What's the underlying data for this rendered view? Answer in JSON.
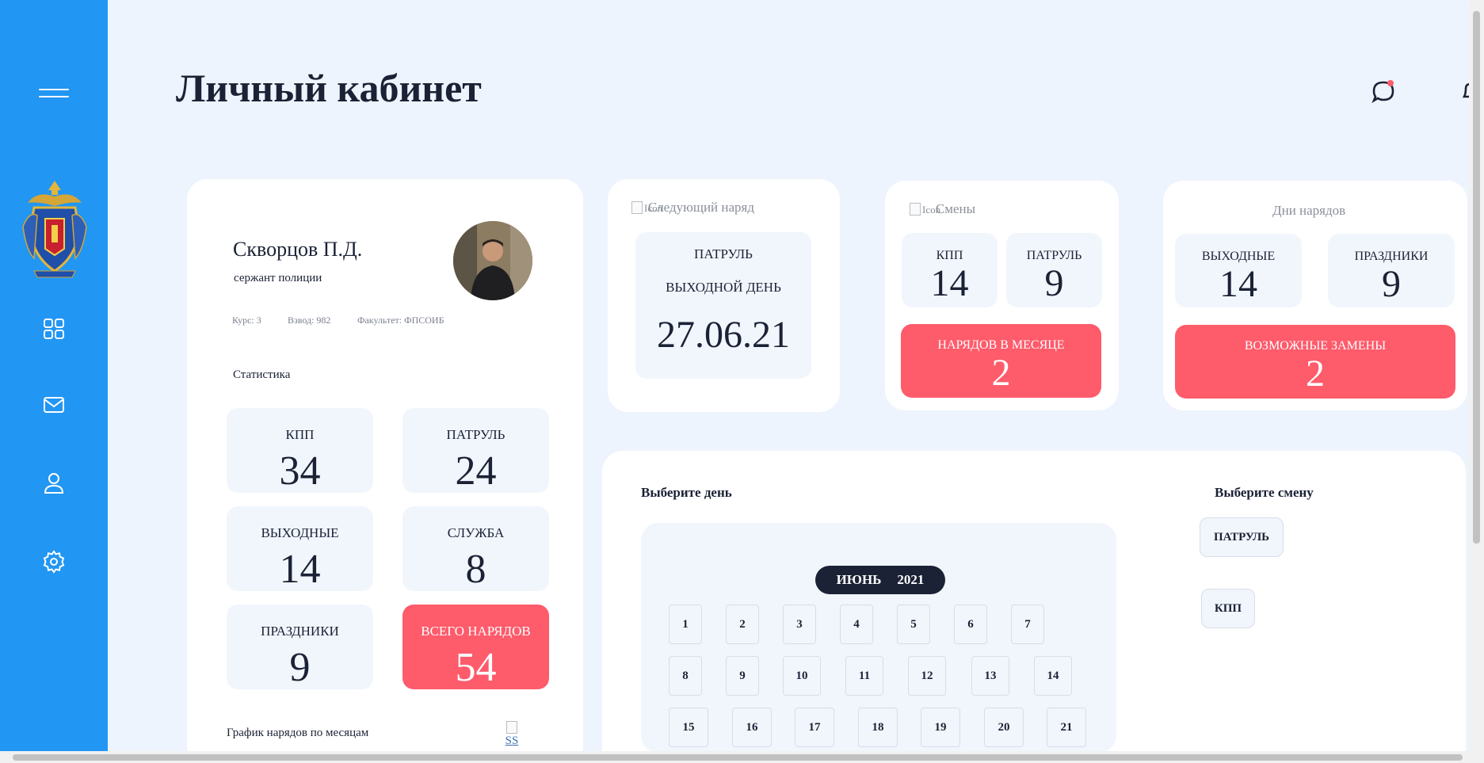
{
  "header": {
    "title": "Личный кабинет",
    "chat_icon": "chat-icon",
    "bell_icon": "bell-icon"
  },
  "sidebar": {
    "menu_icon": "hamburger-icon",
    "logo": "police-emblem",
    "items": [
      {
        "name": "dashboard",
        "icon": "grid-icon"
      },
      {
        "name": "messages",
        "icon": "mail-icon"
      },
      {
        "name": "profile",
        "icon": "user-icon"
      },
      {
        "name": "settings",
        "icon": "gear-icon"
      }
    ]
  },
  "profile": {
    "name": "Скворцов П.Д.",
    "rank": "сержант полиции",
    "course": "Курс: 3",
    "platoon": "Взвод: 982",
    "faculty": "Факультет: ФПСОИБ",
    "stats_title": "Статистика",
    "stats": [
      {
        "label": "КПП",
        "value": "34"
      },
      {
        "label": "ПАТРУЛЬ",
        "value": "24"
      },
      {
        "label": "ВЫХОДНЫЕ",
        "value": "14"
      },
      {
        "label": "СЛУЖБА",
        "value": "8"
      },
      {
        "label": "ПРАЗДНИКИ",
        "value": "9"
      },
      {
        "label": "ВСЕГО НАРЯДОВ",
        "value": "54"
      }
    ],
    "chart_title": "График нарядов по месяцам",
    "chart_alt": "SS"
  },
  "next_duty": {
    "icon_alt": "Icon",
    "title": "Следующий наряд",
    "type": "ПАТРУЛЬ",
    "day": "ВЫХОДНОЙ ДЕНЬ",
    "date": "27.06.21"
  },
  "shifts": {
    "icon_alt": "Icon",
    "title": "Смены",
    "kpp_label": "КПП",
    "kpp_value": "14",
    "patrol_label": "ПАТРУЛЬ",
    "patrol_value": "9",
    "month_label": "НАРЯДОВ В МЕСЯЦЕ",
    "month_value": "2"
  },
  "duty_days": {
    "title": "Дни нарядов",
    "weekend_label": "ВЫХОДНЫЕ",
    "weekend_value": "14",
    "holiday_label": "ПРАЗДНИКИ",
    "holiday_value": "9",
    "swap_label": "ВОЗМОЖНЫЕ ЗАМЕНЫ",
    "swap_value": "2"
  },
  "calendar": {
    "title": "Выберите день",
    "month": "ИЮНЬ",
    "year": "2021",
    "days": [
      "1",
      "2",
      "3",
      "4",
      "5",
      "6",
      "7",
      "8",
      "9",
      "10",
      "11",
      "12",
      "13",
      "14",
      "15",
      "16",
      "17",
      "18",
      "19",
      "20",
      "21"
    ]
  },
  "shift_select": {
    "title": "Выберите смену",
    "options": [
      "ПАТРУЛЬ",
      "КПП"
    ]
  }
}
